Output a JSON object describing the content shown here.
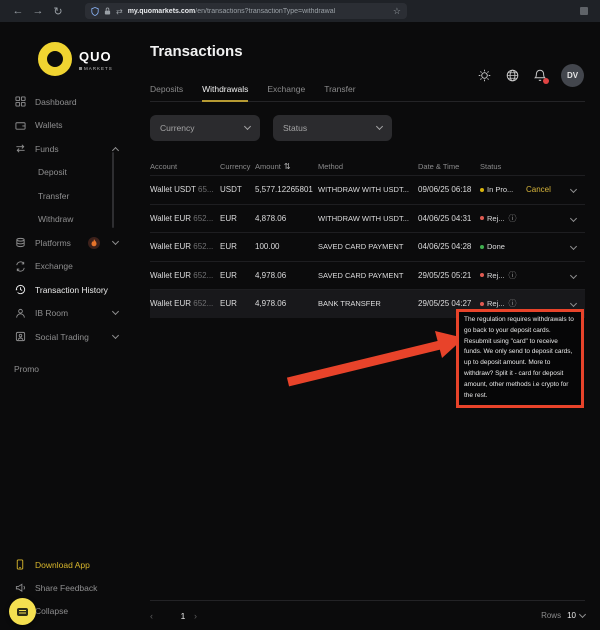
{
  "browser": {
    "url_host": "my.quomarkets.com",
    "url_path": "/en/transactions?transactionType=withdrawal"
  },
  "brand": {
    "name": "QUO",
    "subname": "MARKETS"
  },
  "sidebar": {
    "dashboard": "Dashboard",
    "wallets": "Wallets",
    "funds": "Funds",
    "deposit": "Deposit",
    "transfer": "Transfer",
    "withdraw": "Withdraw",
    "platforms": "Platforms",
    "exchange": "Exchange",
    "transaction_history": "Transaction History",
    "ib_room": "IB Room",
    "social_trading": "Social Trading",
    "promo": "Promo",
    "download_app": "Download App",
    "share_feedback": "Share Feedback",
    "collapse": "Collapse"
  },
  "header": {
    "title": "Transactions",
    "avatar_initials": "DV"
  },
  "tabs": {
    "deposits": "Deposits",
    "withdrawals": "Withdrawals",
    "exchange": "Exchange",
    "transfer": "Transfer",
    "active": "Withdrawals"
  },
  "filters": {
    "currency_label": "Currency",
    "status_label": "Status"
  },
  "table": {
    "headers": {
      "account": "Account",
      "currency": "Currency",
      "amount": "Amount",
      "method": "Method",
      "datetime": "Date & Time",
      "status": "Status"
    },
    "sort_icon": "⇅",
    "rows": [
      {
        "account": "Wallet USDT ",
        "account_suffix": "65...",
        "currency": "USDT",
        "amount": "5,577.12265801",
        "method": "WITHDRAW WITH USDT...",
        "datetime": "09/06/25 06:18",
        "status": "In Pro...",
        "status_kind": "pending",
        "action": "Cancel"
      },
      {
        "account": "Wallet EUR ",
        "account_suffix": "652...",
        "currency": "EUR",
        "amount": "4,878.06",
        "method": "WITHDRAW WITH USDT...",
        "datetime": "04/06/25 04:31",
        "status": "Rej...",
        "status_kind": "rejected"
      },
      {
        "account": "Wallet EUR ",
        "account_suffix": "652...",
        "currency": "EUR",
        "amount": "100.00",
        "method": "SAVED CARD PAYMENT",
        "datetime": "04/06/25 04:28",
        "status": "Done",
        "status_kind": "done"
      },
      {
        "account": "Wallet EUR ",
        "account_suffix": "652...",
        "currency": "EUR",
        "amount": "4,978.06",
        "method": "SAVED CARD PAYMENT",
        "datetime": "29/05/25 05:21",
        "status": "Rej...",
        "status_kind": "rejected"
      },
      {
        "account": "Wallet EUR ",
        "account_suffix": "652...",
        "currency": "EUR",
        "amount": "4,978.06",
        "method": "BANK TRANSFER",
        "datetime": "29/05/25 04:27",
        "status": "Rej...",
        "status_kind": "rejected"
      }
    ]
  },
  "tooltip": {
    "text": "The regulation requires withdrawals to go back to your deposit cards. Resubmit using \"card\" to receive funds. We only send to deposit cards, up to deposit amount. More to withdraw? Split it - card for deposit amount, other methods i.e crypto for the rest."
  },
  "pagination": {
    "page": "1",
    "rows_label": "Rows",
    "rows_per_page": "10"
  },
  "colors": {
    "accent_yellow": "#e0bd3a",
    "logo_yellow": "#f0d431",
    "status_pending": "#d9b40c",
    "status_rejected": "#e05b52",
    "status_done": "#3fae4e",
    "annotation_red": "#e8432a"
  }
}
